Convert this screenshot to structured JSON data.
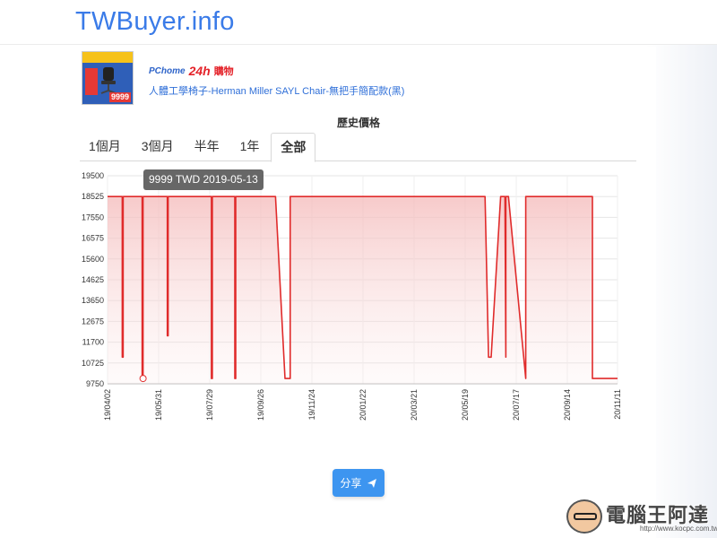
{
  "site": {
    "logo": "TWBuyer.info"
  },
  "product": {
    "store_name": "PChome",
    "store_24": "24h",
    "store_suffix": "購物",
    "title": "人體工學椅子-Herman Miller SAYL Chair-無把手簡配款(黑)",
    "thumb_price": "9999"
  },
  "section": {
    "title": "歷史價格"
  },
  "tabs": [
    {
      "label": "1個月",
      "active": false
    },
    {
      "label": "3個月",
      "active": false
    },
    {
      "label": "半年",
      "active": false
    },
    {
      "label": "1年",
      "active": false
    },
    {
      "label": "全部",
      "active": true
    }
  ],
  "tooltip": {
    "text": "9999 TWD 2019-05-13"
  },
  "share": {
    "label": "分享"
  },
  "watermark": {
    "text": "電腦王阿達",
    "url": "http://www.kocpc.com.tw"
  },
  "colors": {
    "accent": "#3a7be8",
    "line": "#e02b2b",
    "fill_top": "#f7c6c6",
    "share": "#3d95f0"
  },
  "chart_data": {
    "type": "area",
    "title": "",
    "xlabel": "",
    "ylabel": "",
    "ylim": [
      9750,
      19500
    ],
    "xlim": [
      "2019-04-02",
      "2020-11-11"
    ],
    "y_ticks": [
      9750,
      10725,
      11700,
      12675,
      13650,
      14625,
      15600,
      16575,
      17550,
      18525,
      19500
    ],
    "x_ticks": [
      "19/04/02",
      "19/05/31",
      "19/07/29",
      "19/09/26",
      "19/11/24",
      "20/01/22",
      "20/03/21",
      "20/05/19",
      "20/07/17",
      "20/09/14",
      "20/11/11"
    ],
    "grid": true,
    "highlight": {
      "date": "2019-05-13",
      "value": 9999
    },
    "series": [
      {
        "values": [
          [
            "2019-04-02",
            18525
          ],
          [
            "2019-04-19",
            18525
          ],
          [
            "2019-04-19",
            11000
          ],
          [
            "2019-04-20",
            11000
          ],
          [
            "2019-04-20",
            18525
          ],
          [
            "2019-05-12",
            18525
          ],
          [
            "2019-05-12",
            9999
          ],
          [
            "2019-05-13",
            9999
          ],
          [
            "2019-05-13",
            18525
          ],
          [
            "2019-06-10",
            18525
          ],
          [
            "2019-06-10",
            12000
          ],
          [
            "2019-06-11",
            12000
          ],
          [
            "2019-06-11",
            18525
          ],
          [
            "2019-07-31",
            18525
          ],
          [
            "2019-07-31",
            9999
          ],
          [
            "2019-08-01",
            9999
          ],
          [
            "2019-08-01",
            18525
          ],
          [
            "2019-08-27",
            18525
          ],
          [
            "2019-08-27",
            9999
          ],
          [
            "2019-08-28",
            9999
          ],
          [
            "2019-08-28",
            18525
          ],
          [
            "2019-10-13",
            18525
          ],
          [
            "2019-10-24",
            9999
          ],
          [
            "2019-10-30",
            9999
          ],
          [
            "2019-10-30",
            18525
          ],
          [
            "2020-06-11",
            18525
          ],
          [
            "2020-06-15",
            11000
          ],
          [
            "2020-06-18",
            11000
          ],
          [
            "2020-06-29",
            18525
          ],
          [
            "2020-07-04",
            18525
          ],
          [
            "2020-07-05",
            11000
          ],
          [
            "2020-07-05",
            18525
          ],
          [
            "2020-07-08",
            18525
          ],
          [
            "2020-07-28",
            9999
          ],
          [
            "2020-07-28",
            18525
          ],
          [
            "2020-10-13",
            18525
          ],
          [
            "2020-10-13",
            9999
          ],
          [
            "2020-11-11",
            9999
          ]
        ]
      }
    ]
  }
}
